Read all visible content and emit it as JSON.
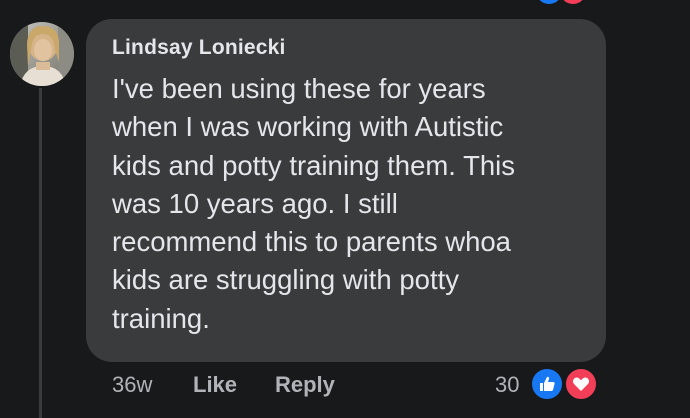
{
  "comment": {
    "author": "Lindsay Loniecki",
    "lines": [
      "I've been using these for years",
      "when I was working with Autistic",
      "kids and potty training them. This",
      "was 10 years ago. I still",
      "recommend this to parents whoa",
      "kids are struggling with potty",
      "training."
    ]
  },
  "actions": {
    "time": "36w",
    "like_label": "Like",
    "reply_label": "Reply",
    "reaction_count": "30"
  },
  "reactions": [
    "thumbs-up-icon",
    "heart-icon"
  ],
  "colors": {
    "background": "#18191a",
    "bubble": "#3a3b3c",
    "text": "#e4e6eb",
    "secondary_text": "#b0b3b8",
    "like_blue": "#1877f2",
    "love_red": "#f33e58"
  }
}
